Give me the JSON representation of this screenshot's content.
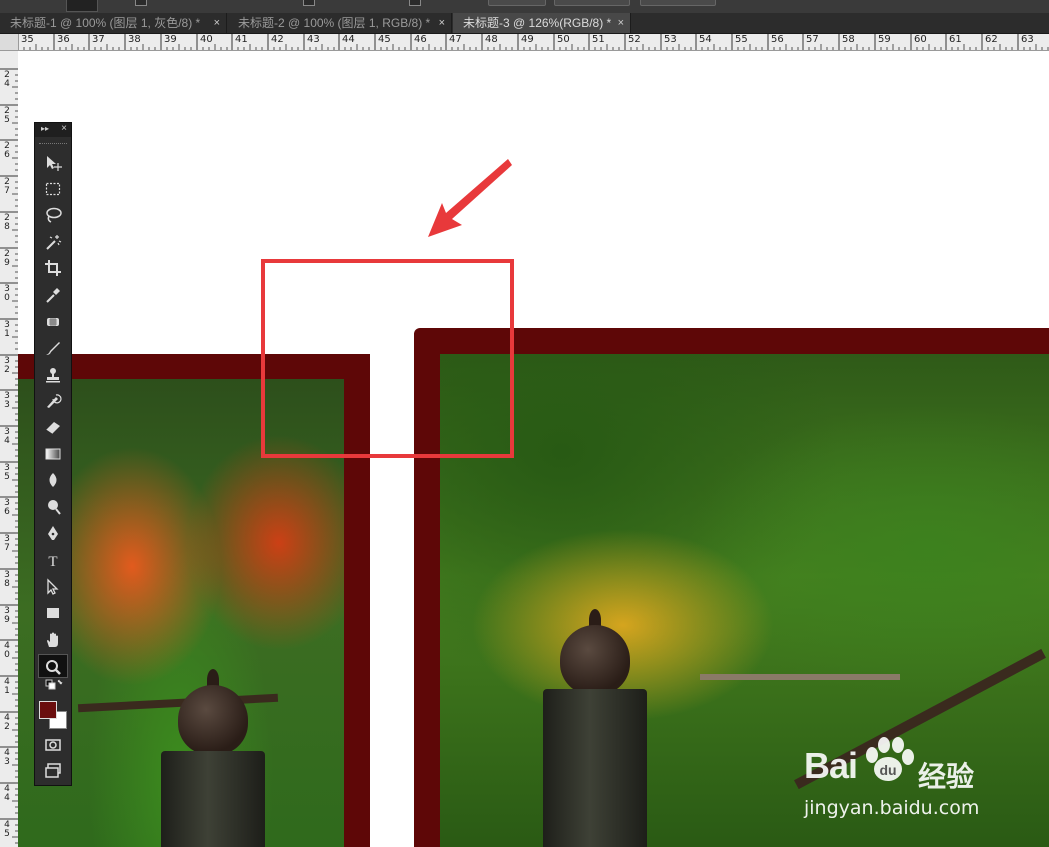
{
  "tabs": [
    {
      "label": "未标题-1 @ 100% (图层 1, 灰色/8) *",
      "close": "×",
      "active": false
    },
    {
      "label": "未标题-2 @ 100% (图层 1, RGB/8) *",
      "close": "×",
      "active": false
    },
    {
      "label": "未标题-3 @ 126%(RGB/8) *",
      "close": "×",
      "active": true
    }
  ],
  "ruler": {
    "horizontal": [
      "35",
      "36",
      "37",
      "38",
      "39",
      "40",
      "41",
      "42",
      "43",
      "44",
      "45",
      "46",
      "47",
      "48",
      "49",
      "50",
      "51",
      "52",
      "53",
      "54",
      "55",
      "56",
      "57",
      "58",
      "59",
      "60",
      "61",
      "62",
      "63"
    ],
    "vertical": [
      [
        "2",
        "4"
      ],
      [
        "2",
        "5"
      ],
      [
        "2",
        "6"
      ],
      [
        "2",
        "7"
      ],
      [
        "2",
        "8"
      ],
      [
        "2",
        "9"
      ],
      [
        "3",
        "0"
      ],
      [
        "3",
        "1"
      ],
      [
        "3",
        "2"
      ],
      [
        "3",
        "3"
      ],
      [
        "3",
        "4"
      ],
      [
        "3",
        "5"
      ],
      [
        "3",
        "6"
      ],
      [
        "3",
        "7"
      ],
      [
        "3",
        "8"
      ],
      [
        "3",
        "9"
      ],
      [
        "4",
        "0"
      ],
      [
        "4",
        "1"
      ],
      [
        "4",
        "2"
      ],
      [
        "4",
        "3"
      ],
      [
        "4",
        "4"
      ],
      [
        "4",
        "5"
      ]
    ]
  },
  "toolbox": {
    "header_arrows": "▸▸",
    "close": "×",
    "tools": [
      {
        "name": "move-tool",
        "icon": "move-icon"
      },
      {
        "name": "marquee-tool",
        "icon": "rect-marquee-icon"
      },
      {
        "name": "lasso-tool",
        "icon": "lasso-icon"
      },
      {
        "name": "magic-wand-tool",
        "icon": "magic-wand-icon"
      },
      {
        "name": "crop-tool",
        "icon": "crop-icon"
      },
      {
        "name": "eyedropper-tool",
        "icon": "eyedropper-icon"
      },
      {
        "name": "healing-brush-tool",
        "icon": "healing-icon"
      },
      {
        "name": "brush-tool",
        "icon": "brush-icon"
      },
      {
        "name": "clone-stamp-tool",
        "icon": "stamp-icon"
      },
      {
        "name": "history-brush-tool",
        "icon": "history-brush-icon"
      },
      {
        "name": "eraser-tool",
        "icon": "eraser-icon"
      },
      {
        "name": "gradient-tool",
        "icon": "gradient-icon"
      },
      {
        "name": "blur-tool",
        "icon": "blur-icon"
      },
      {
        "name": "dodge-tool",
        "icon": "dodge-icon"
      },
      {
        "name": "pen-tool",
        "icon": "pen-icon"
      },
      {
        "name": "type-tool",
        "icon": "type-icon",
        "glyph": "T"
      },
      {
        "name": "path-selection-tool",
        "icon": "path-select-icon"
      },
      {
        "name": "rectangle-tool",
        "icon": "rectangle-icon"
      },
      {
        "name": "hand-tool",
        "icon": "hand-icon"
      },
      {
        "name": "zoom-tool",
        "icon": "zoom-icon",
        "selected": true
      }
    ],
    "foreground_color": "#6a0e0e",
    "background_color": "#ffffff"
  },
  "annotation": {
    "box_color": "#e8393b",
    "arrow_color": "#e8393b"
  },
  "watermark": {
    "brand": "Bai",
    "brand_suffix": "经验",
    "url": "jingyan.baidu.com"
  }
}
